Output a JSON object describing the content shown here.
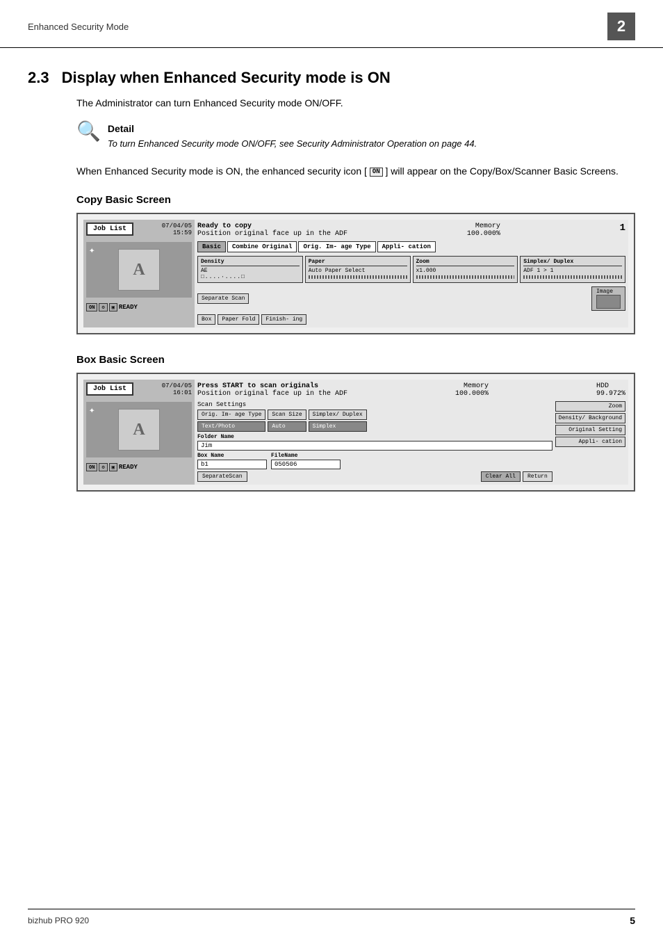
{
  "header": {
    "title": "Enhanced Security Mode",
    "page_number": "2"
  },
  "section": {
    "number": "2.3",
    "title": "Display when Enhanced Security mode is ON"
  },
  "intro": {
    "text": "The Administrator can turn Enhanced Security mode ON/OFF."
  },
  "detail": {
    "label": "Detail",
    "text": "To turn Enhanced Security mode ON/OFF, see Security Administrator Operation on page 44."
  },
  "body": {
    "text": "When Enhanced Security mode is ON, the enhanced security icon [",
    "text2": "] will appear on the Copy/Box/Scanner Basic Screens.",
    "icon_label": "ON"
  },
  "copy_screen": {
    "heading": "Copy Basic Screen",
    "job_list": "Job List",
    "date": "07/04/05",
    "time": "15:59",
    "status_line1": "Ready to copy",
    "status_line2": "Position original face up in the ADF",
    "memory": "Memory",
    "memory_pct": "100.000%",
    "page_num": "1",
    "tabs": [
      "Basic",
      "Combine Original",
      "Orig. Im- age Type",
      "Appli- cation"
    ],
    "density_label": "Density",
    "density_value": "AE",
    "paper_label": "Paper",
    "paper_value": "Auto Paper Select",
    "zoom_label": "Zoom",
    "zoom_value": "x1.000",
    "duplex_label": "Simplex/ Duplex",
    "duplex_value": "ADF 1 > 1",
    "separate_scan": "Separate Scan",
    "box": "Box",
    "paper_fold": "Paper Fold",
    "finishing": "Finish- ing",
    "image": "Image",
    "icon_on": "ON",
    "ready": "READY"
  },
  "box_screen": {
    "heading": "Box Basic Screen",
    "job_list": "Job List",
    "date": "07/04/05",
    "time": "16:01",
    "status_line1": "Press START to scan originals",
    "status_line2": "Position original face up in the ADF",
    "memory": "Memory",
    "memory_pct": "100.000%",
    "hdd": "HDD",
    "hdd_pct": "99.972%",
    "scan_settings": "Scan Settings",
    "orig_type_label": "Orig. Im- age Type",
    "orig_type_value": "Text/Photo",
    "scan_size_label": "Scan Size",
    "scan_size_value": "Auto",
    "duplex_label": "Simplex/ Duplex",
    "duplex_value": "Simplex",
    "zoom_label": "Zoom",
    "density_label": "Density/ Background",
    "original_setting": "Original Setting",
    "appli_label": "Appli- cation",
    "folder_label": "Folder Name",
    "folder_value": "Jim",
    "box_label": "Box Name",
    "box_value": "b1",
    "filename_label": "FileName",
    "filename_value": "050506",
    "separate_scan": "SeparateScan",
    "clear_all": "Clear All",
    "return": "Return",
    "icon_on": "ON",
    "ready": "READY"
  },
  "footer": {
    "product": "bizhub PRO 920",
    "page": "5"
  }
}
